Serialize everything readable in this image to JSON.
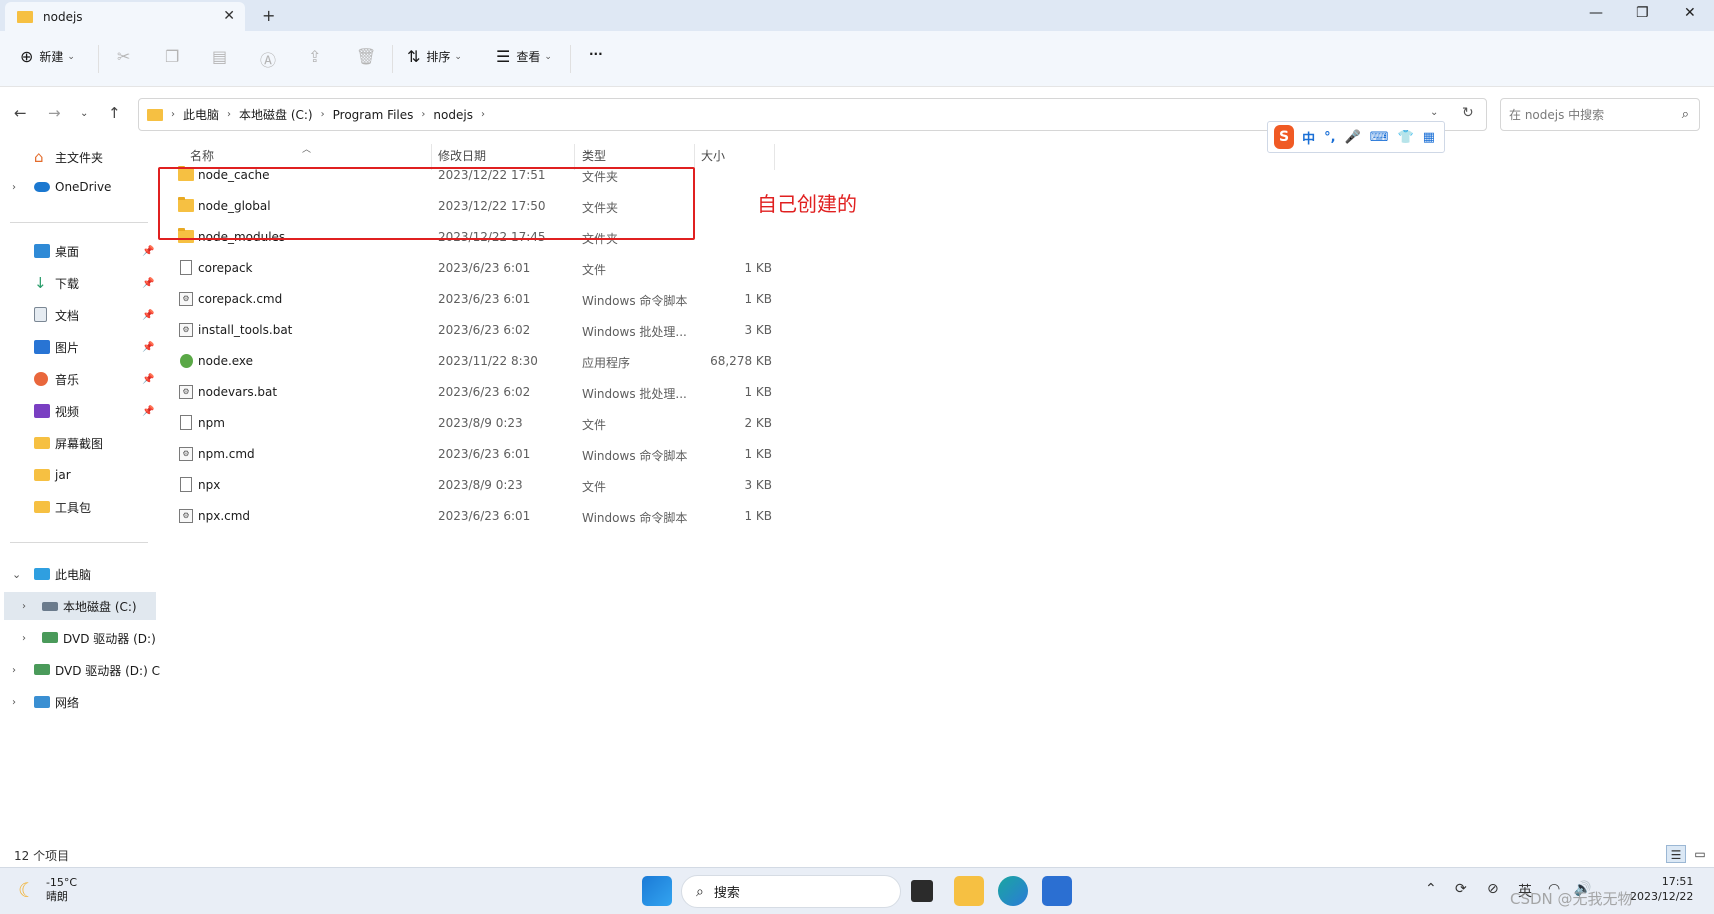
{
  "window": {
    "tab_title": "nodejs",
    "tab_close": "✕",
    "new_tab": "+",
    "minimize": "—",
    "maximize": "❐",
    "close": "✕"
  },
  "toolbar": {
    "new_label": "新建",
    "sort_label": "排序",
    "view_label": "查看",
    "more_label": "···"
  },
  "address": {
    "crumbs": [
      "此电脑",
      "本地磁盘 (C:)",
      "Program Files",
      "nodejs"
    ],
    "search_placeholder": "在 nodejs 中搜索"
  },
  "sidebar": {
    "quick": [
      {
        "label": "主文件夹"
      },
      {
        "label": "OneDrive"
      }
    ],
    "pinned": [
      {
        "label": "桌面",
        "color": "#2f8ad6"
      },
      {
        "label": "下载",
        "color": "#2a9d6b"
      },
      {
        "label": "文档",
        "color": "#7b8794"
      },
      {
        "label": "图片",
        "color": "#2874d4"
      },
      {
        "label": "音乐",
        "color": "#e9673c"
      },
      {
        "label": "视频",
        "color": "#7a3fc2"
      },
      {
        "label": "屏幕截图",
        "color": "#f6c042"
      },
      {
        "label": "jar",
        "color": "#f6c042"
      },
      {
        "label": "工具包",
        "color": "#f6c042"
      }
    ],
    "tree": [
      {
        "label": "此电脑"
      },
      {
        "label": "本地磁盘 (C:)"
      },
      {
        "label": "DVD 驱动器 (D:)"
      },
      {
        "label": "DVD 驱动器 (D:) C"
      },
      {
        "label": "网络"
      }
    ]
  },
  "columns": {
    "name": "名称",
    "date": "修改日期",
    "type": "类型",
    "size": "大小"
  },
  "files": [
    {
      "name": "node_cache",
      "date": "2023/12/22 17:51",
      "type": "文件夹",
      "size": "",
      "icon": "folder"
    },
    {
      "name": "node_global",
      "date": "2023/12/22 17:50",
      "type": "文件夹",
      "size": "",
      "icon": "folder"
    },
    {
      "name": "node_modules",
      "date": "2023/12/22 17:45",
      "type": "文件夹",
      "size": "",
      "icon": "folder"
    },
    {
      "name": "corepack",
      "date": "2023/6/23 6:01",
      "type": "文件",
      "size": "1 KB",
      "icon": "file"
    },
    {
      "name": "corepack.cmd",
      "date": "2023/6/23 6:01",
      "type": "Windows 命令脚本",
      "size": "1 KB",
      "icon": "script"
    },
    {
      "name": "install_tools.bat",
      "date": "2023/6/23 6:02",
      "type": "Windows 批处理...",
      "size": "3 KB",
      "icon": "script"
    },
    {
      "name": "node.exe",
      "date": "2023/11/22 8:30",
      "type": "应用程序",
      "size": "68,278 KB",
      "icon": "exe"
    },
    {
      "name": "nodevars.bat",
      "date": "2023/6/23 6:02",
      "type": "Windows 批处理...",
      "size": "1 KB",
      "icon": "script"
    },
    {
      "name": "npm",
      "date": "2023/8/9 0:23",
      "type": "文件",
      "size": "2 KB",
      "icon": "file"
    },
    {
      "name": "npm.cmd",
      "date": "2023/6/23 6:01",
      "type": "Windows 命令脚本",
      "size": "1 KB",
      "icon": "script"
    },
    {
      "name": "npx",
      "date": "2023/8/9 0:23",
      "type": "文件",
      "size": "3 KB",
      "icon": "file"
    },
    {
      "name": "npx.cmd",
      "date": "2023/6/23 6:01",
      "type": "Windows 命令脚本",
      "size": "1 KB",
      "icon": "script"
    }
  ],
  "annotation": {
    "text": "自己创建的",
    "color": "#e02020"
  },
  "ime": {
    "logo": "S",
    "mode": "中",
    "punct": "°,"
  },
  "status": {
    "item_count": "12 个项目"
  },
  "taskbar": {
    "temperature": "-15°C",
    "weather": "晴朗",
    "search_label": "搜索",
    "ime_lang": "英",
    "time": "17:51",
    "date": "2023/12/22",
    "watermark": "CSDN @无我无物"
  }
}
